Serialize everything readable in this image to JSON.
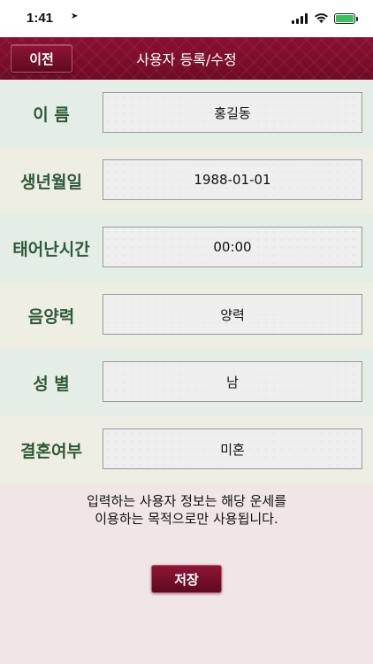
{
  "status": {
    "time": "1:41",
    "location_icon": "location-arrow-icon",
    "battery_color": "#36c15b"
  },
  "nav": {
    "back_label": "이전",
    "title": "사용자 등록/수정",
    "bar_color": "#7a0d2a"
  },
  "form": {
    "rows": [
      {
        "label": "이 름",
        "value": "홍길동",
        "row_bg": "#e4eee6"
      },
      {
        "label": "생년월일",
        "value": "1988-01-01",
        "row_bg": "#eeeee4"
      },
      {
        "label": "태어난시간",
        "value": "00:00",
        "row_bg": "#e4eee6"
      },
      {
        "label": "음양력",
        "value": "양력",
        "row_bg": "#eeeee4"
      },
      {
        "label": "성 별",
        "value": "남",
        "row_bg": "#e4eee6"
      },
      {
        "label": "결혼여부",
        "value": "미혼",
        "row_bg": "#eeeee4"
      }
    ],
    "label_color": "#2e5a3a"
  },
  "notice": {
    "line1": "입력하는 사용자 정보는 해당 운세를",
    "line2": "이용하는 목적으로만 사용됩니다."
  },
  "save_label": "저장"
}
